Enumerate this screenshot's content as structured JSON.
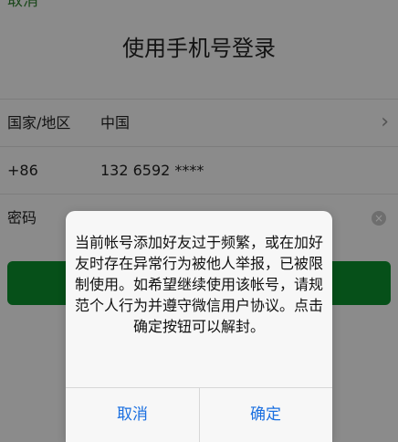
{
  "header": {
    "cancel_label": "取消",
    "title": "使用手机号登录"
  },
  "form": {
    "region_label": "国家/地区",
    "region_value": "中国",
    "country_code_label": "+86",
    "phone_value": "132 6592 ****",
    "password_label": "密码"
  },
  "dialog": {
    "message": "当前帐号添加好友过于频繁，或在加好友时存在异常行为被他人举报，已被限制使用。如希望继续使用该帐号，请规范个人行为并遵守微信用户协议。点击确定按钮可以解封。",
    "cancel_label": "取消",
    "confirm_label": "确定"
  },
  "colors": {
    "green": "#0c8b2b",
    "blue": "#1a6fe0"
  },
  "icons": {
    "chevron": "chevron-right-icon",
    "clear": "clear-icon"
  }
}
